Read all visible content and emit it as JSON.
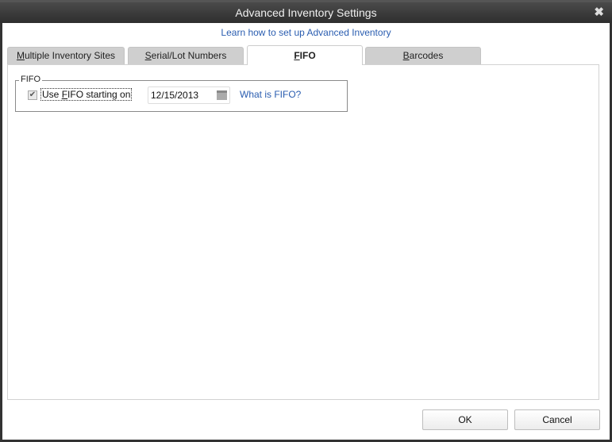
{
  "window": {
    "title": "Advanced Inventory Settings",
    "close_icon": "close-icon"
  },
  "help_link": "Learn how to set up Advanced Inventory",
  "tabs": [
    {
      "label": "Multiple Inventory Sites",
      "mnemonic": "M",
      "rest": "ultiple Inventory Sites",
      "active": false
    },
    {
      "label": "Serial/Lot Numbers",
      "mnemonic": "S",
      "rest": "erial/Lot Numbers",
      "active": false
    },
    {
      "label": "FIFO",
      "mnemonic": "F",
      "rest": "IFO",
      "active": true
    },
    {
      "label": "Barcodes",
      "mnemonic": "B",
      "rest": "arcodes",
      "active": false
    }
  ],
  "fifo": {
    "group_label": "FIFO",
    "checkbox_checked": true,
    "checkbox_label_pre": "Use ",
    "checkbox_label_mnemonic": "F",
    "checkbox_label_post": "IFO starting on",
    "date_value": "12/15/2013",
    "calendar_icon": "calendar-icon",
    "what_is_link": "What is FIFO?"
  },
  "buttons": {
    "ok": "OK",
    "cancel": "Cancel"
  }
}
